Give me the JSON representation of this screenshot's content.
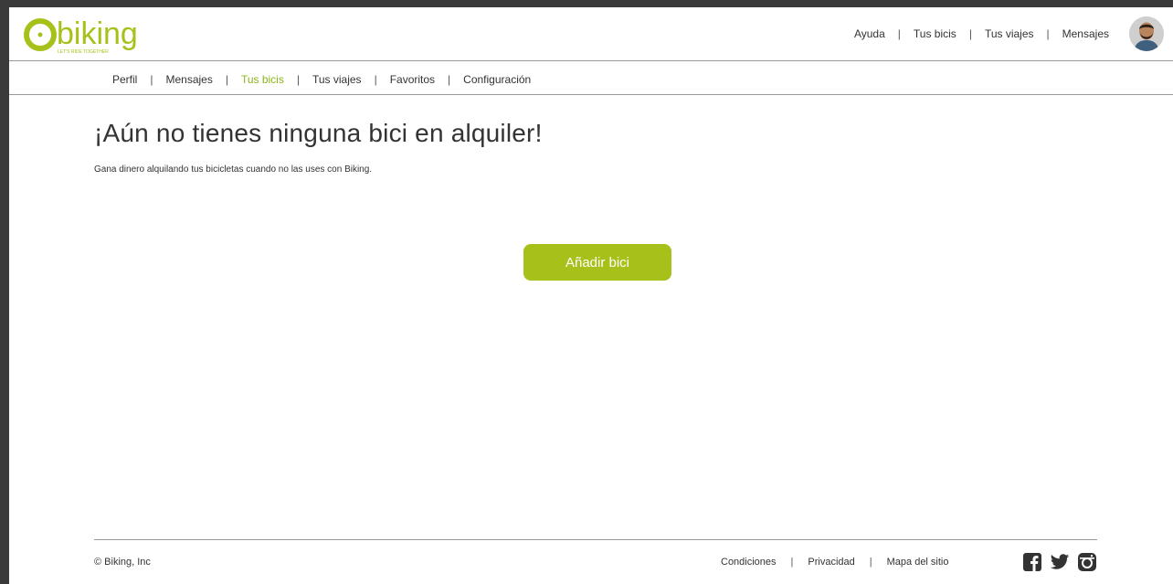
{
  "brand": {
    "name": "biking",
    "tagline": "LET'S RIDE TOGETHER",
    "color": "#a8c11a"
  },
  "topnav": {
    "links": [
      "Ayuda",
      "Tus bicis",
      "Tus viajes",
      "Mensajes"
    ],
    "separator": "|"
  },
  "subnav": {
    "items": [
      "Perfil",
      "Mensajes",
      "Tus bicis",
      "Tus viajes",
      "Favoritos",
      "Configuración"
    ],
    "active": "Tus bicis",
    "separator": "|"
  },
  "main": {
    "headline": "¡Aún no tienes ninguna bici en alquiler!",
    "subtitle": "Gana dinero alquilando tus bicicletas cuando no las uses con Biking.",
    "add_button": "Añadir bici"
  },
  "footer": {
    "copyright": "© Biking, Inc",
    "links": [
      "Condiciones",
      "Privacidad",
      "Mapa del sitio"
    ],
    "separator": "|",
    "socials": [
      "facebook-icon",
      "twitter-icon",
      "instagram-icon"
    ]
  },
  "colors": {
    "accent": "#a8c11a",
    "active_link": "#8ab51a",
    "text": "#333333"
  }
}
